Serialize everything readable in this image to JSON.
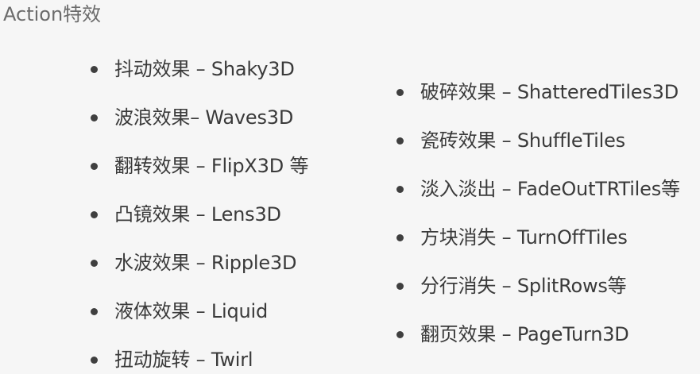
{
  "slide": {
    "title": "Action特效",
    "left_items": [
      "抖动效果 – Shaky3D",
      "波浪效果– Waves3D",
      "翻转效果 – FlipX3D 等",
      "凸镜效果 – Lens3D",
      "水波效果 – Ripple3D",
      "液体效果 – Liquid",
      "扭动旋转 – Twirl"
    ],
    "right_items": [
      "破碎效果 – ShatteredTiles3D",
      "瓷砖效果 – ShuffleTiles",
      "淡入淡出 – FadeOutTRTiles等",
      "方块消失 – TurnOffTiles",
      "分行消失 – SplitRows等",
      "翻页效果 – PageTurn3D"
    ]
  }
}
